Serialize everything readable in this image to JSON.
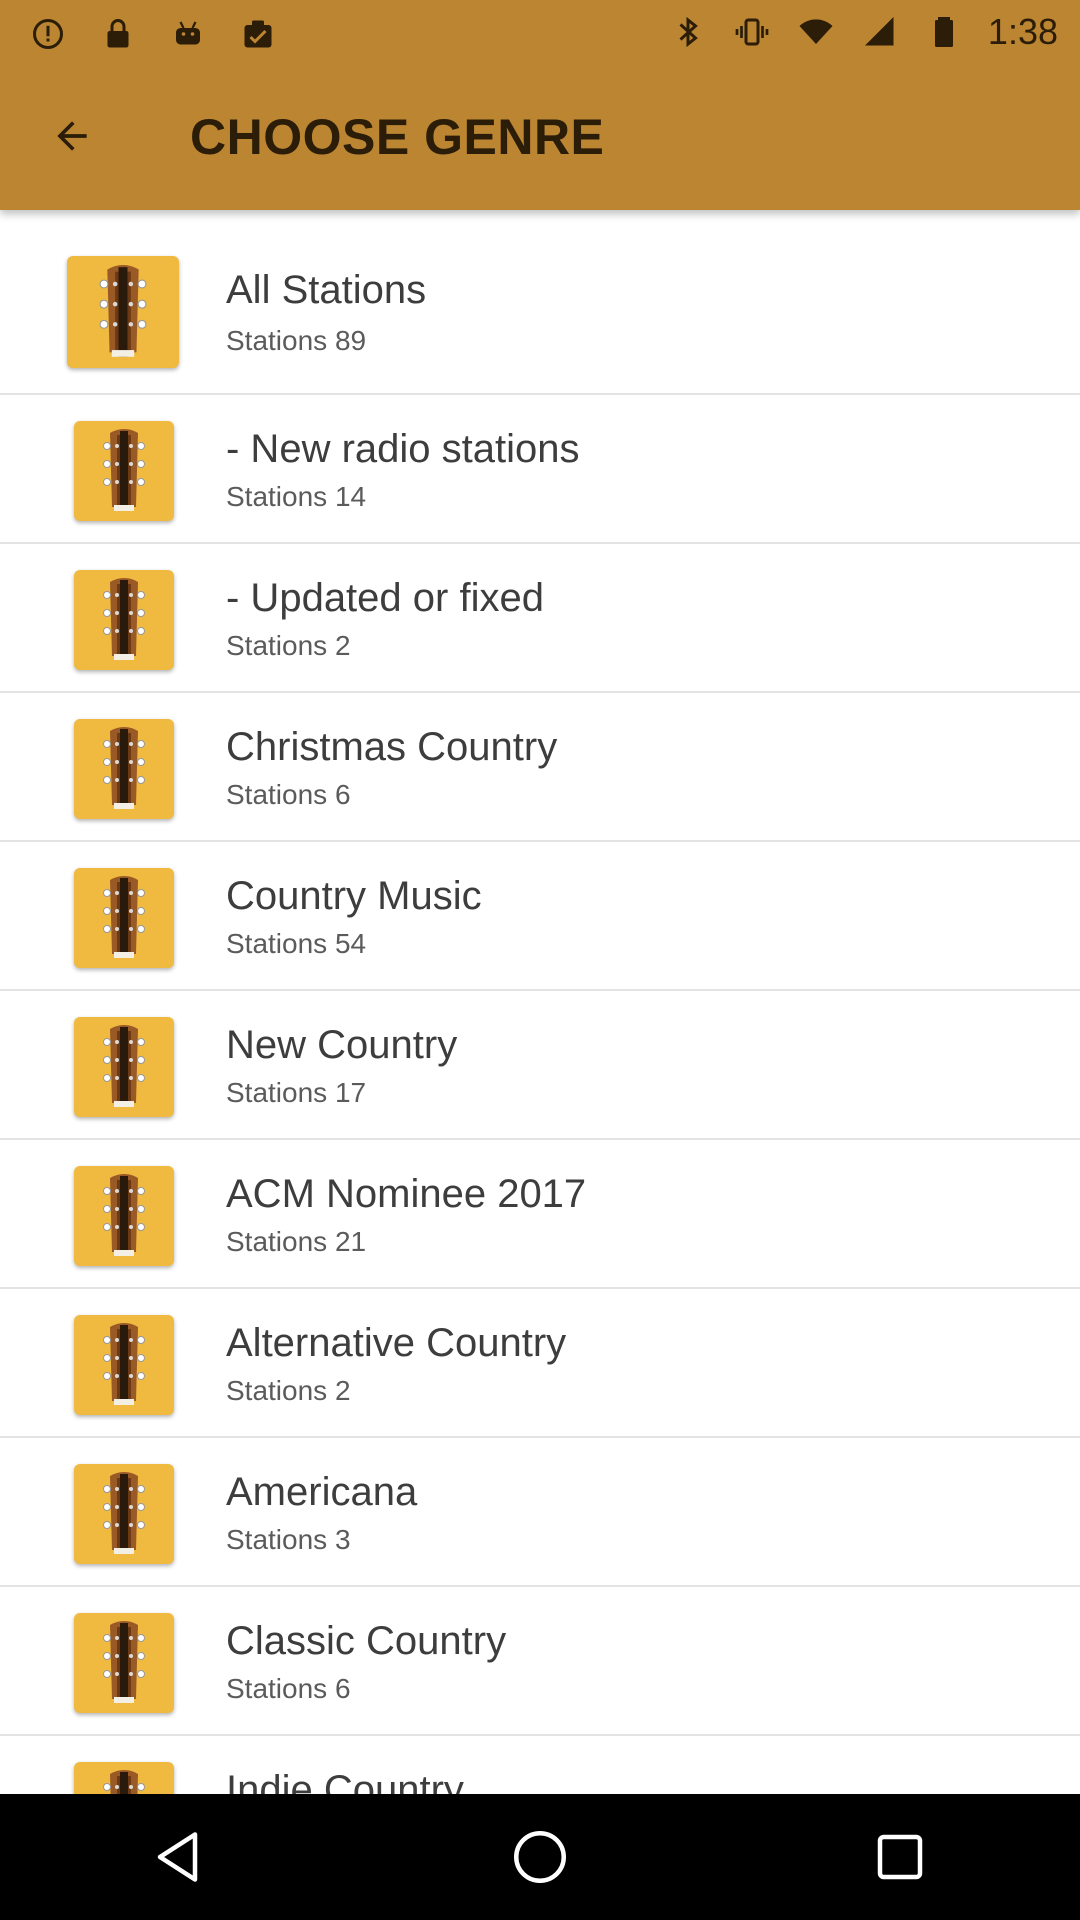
{
  "status_bar": {
    "time": "1:38",
    "left_icons": [
      "alert-icon",
      "lock-icon",
      "android-icon",
      "clipboard-check-icon"
    ],
    "right_icons": [
      "bluetooth-icon",
      "vibrate-icon",
      "wifi-icon",
      "signal-icon",
      "battery-icon"
    ]
  },
  "header": {
    "title": "CHOOSE GENRE",
    "back_icon": "arrow-back-icon",
    "color": "#bb8532"
  },
  "genres": [
    {
      "name": "All Stations",
      "count": "Stations 89"
    },
    {
      "name": "- New radio stations",
      "count": "Stations 14"
    },
    {
      "name": "- Updated or fixed",
      "count": "Stations 2"
    },
    {
      "name": "Christmas Country",
      "count": "Stations 6"
    },
    {
      "name": "Country Music",
      "count": "Stations 54"
    },
    {
      "name": "New Country",
      "count": "Stations 17"
    },
    {
      "name": "ACM Nominee 2017",
      "count": "Stations 21"
    },
    {
      "name": "Alternative Country",
      "count": "Stations 2"
    },
    {
      "name": "Americana",
      "count": "Stations 3"
    },
    {
      "name": "Classic Country",
      "count": "Stations 6"
    },
    {
      "name": "Indie Country",
      "count": ""
    }
  ],
  "nav_bar": {
    "buttons": [
      "back-triangle-icon",
      "home-circle-icon",
      "recents-square-icon"
    ]
  }
}
